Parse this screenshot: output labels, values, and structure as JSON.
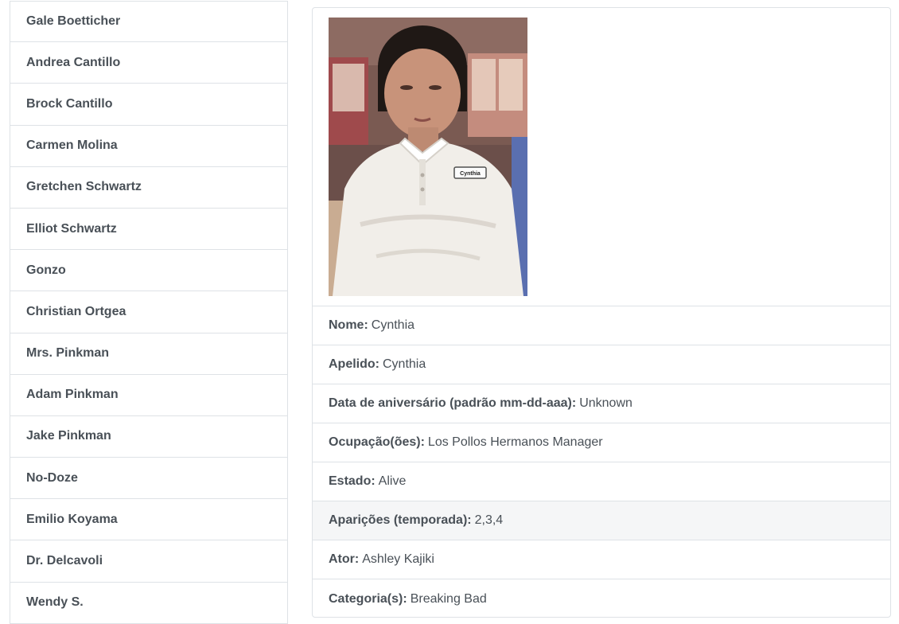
{
  "sidebar": {
    "items": [
      {
        "label": "Gale Boetticher"
      },
      {
        "label": "Andrea Cantillo"
      },
      {
        "label": "Brock Cantillo"
      },
      {
        "label": "Carmen Molina"
      },
      {
        "label": "Gretchen Schwartz"
      },
      {
        "label": "Elliot Schwartz"
      },
      {
        "label": "Gonzo"
      },
      {
        "label": "Christian Ortgea"
      },
      {
        "label": "Mrs. Pinkman"
      },
      {
        "label": "Adam Pinkman"
      },
      {
        "label": "Jake Pinkman"
      },
      {
        "label": "No-Doze"
      },
      {
        "label": "Emilio Koyama"
      },
      {
        "label": "Dr. Delcavoli"
      },
      {
        "label": "Wendy S."
      }
    ]
  },
  "detail": {
    "photo_name_tag": "Cynthia",
    "rows": [
      {
        "label": "Nome:",
        "value": "Cynthia"
      },
      {
        "label": "Apelido:",
        "value": "Cynthia"
      },
      {
        "label": "Data de aniversário (padrão mm-dd-aaa):",
        "value": "Unknown"
      },
      {
        "label": "Ocupação(ões):",
        "value": "Los Pollos Hermanos Manager"
      },
      {
        "label": "Estado:",
        "value": "Alive"
      },
      {
        "label": "Aparições (temporada):",
        "value": "2,3,4"
      },
      {
        "label": "Ator:",
        "value": "Ashley Kajiki"
      },
      {
        "label": "Categoria(s):",
        "value": "Breaking Bad"
      }
    ]
  },
  "colors": {
    "border": "#dee2e6",
    "text": "#495057",
    "highlight_row": "#f5f6f7"
  }
}
